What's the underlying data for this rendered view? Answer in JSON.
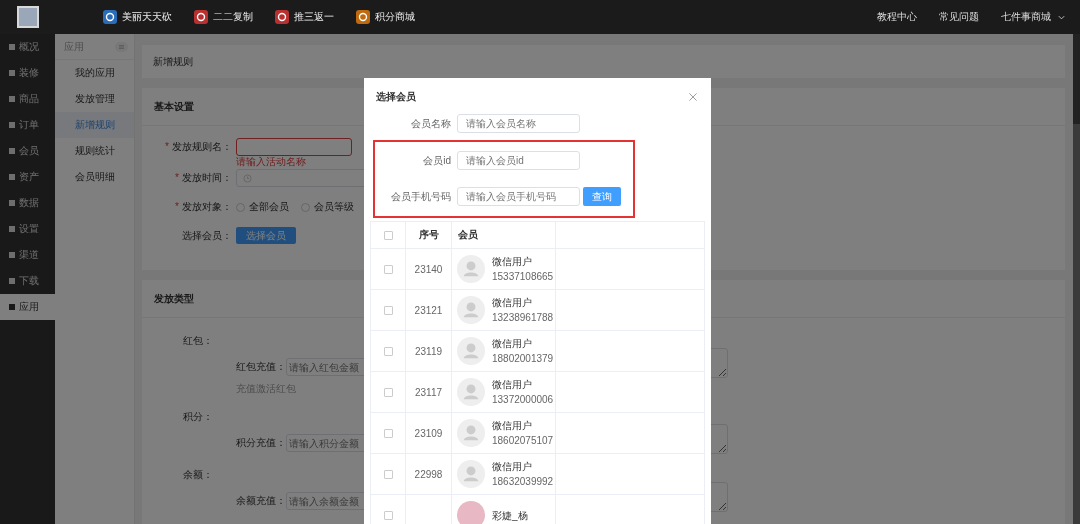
{
  "top_bar": {
    "nav": [
      {
        "label": "美丽天天砍",
        "color": "#2a6cb8"
      },
      {
        "label": "二二复制",
        "color": "#b83030"
      },
      {
        "label": "推三返一",
        "color": "#b83030"
      },
      {
        "label": "积分商城",
        "color": "#c06a10"
      }
    ],
    "links": [
      "教程中心",
      "常见问题"
    ],
    "shop_menu": "七件事商城"
  },
  "sidebar": {
    "items": [
      {
        "label": "概况",
        "selected": false
      },
      {
        "label": "装修",
        "selected": false
      },
      {
        "label": "商品",
        "selected": false
      },
      {
        "label": "订单",
        "selected": false
      },
      {
        "label": "会员",
        "selected": false
      },
      {
        "label": "资产",
        "selected": false
      },
      {
        "label": "数据",
        "selected": false
      },
      {
        "label": "设置",
        "selected": false
      },
      {
        "label": "渠道",
        "selected": false
      },
      {
        "label": "下载",
        "selected": false
      },
      {
        "label": "应用",
        "selected": true
      }
    ]
  },
  "sub_sidebar": {
    "title": "应用",
    "items": [
      {
        "label": "我的应用",
        "selected": false
      },
      {
        "label": "发放管理",
        "selected": false
      },
      {
        "label": "新增规则",
        "selected": true
      },
      {
        "label": "规则统计",
        "selected": false
      },
      {
        "label": "会员明细",
        "selected": false
      }
    ]
  },
  "breadcrumb": "新增规则",
  "basic_settings": {
    "title": "基本设置",
    "rule_name": {
      "required_mark": "*",
      "label": "发放规则名：",
      "error": "请输入活动名称"
    },
    "time": {
      "required_mark": "*",
      "label": "发放时间："
    },
    "target": {
      "required_mark": "*",
      "label": "发放对象：",
      "options": [
        {
          "label": "全部会员",
          "selected": false
        },
        {
          "label": "会员等级",
          "selected": false
        }
      ]
    },
    "member": {
      "label": "选择会员：",
      "button": "选择会员"
    }
  },
  "issue_type": {
    "title": "发放类型",
    "groups": [
      {
        "label": "红包：",
        "field_label": "红包充值：",
        "placeholder": "请输入红包金额",
        "hint": "充值激活红包"
      },
      {
        "label": "积分：",
        "field_label": "积分充值：",
        "placeholder": "请输入积分金额"
      },
      {
        "label": "余额：",
        "field_label": "余额充值：",
        "placeholder": "请输入余额金额"
      }
    ]
  },
  "modal": {
    "title": "选择会员",
    "fields": [
      {
        "label": "会员名称",
        "placeholder": "请输入会员名称",
        "highlighted": false
      },
      {
        "label": "会员id",
        "placeholder": "请输入会员id",
        "highlighted": true
      },
      {
        "label": "会员手机号码",
        "placeholder": "请输入会员手机号码",
        "highlighted": true
      }
    ],
    "query_button": "查询",
    "table": {
      "columns": [
        "序号",
        "会员"
      ],
      "header_checked": false,
      "rows": [
        {
          "checked": false,
          "id": "23140",
          "name": "微信用户",
          "phone": "15337108665"
        },
        {
          "checked": false,
          "id": "23121",
          "name": "微信用户",
          "phone": "13238961788"
        },
        {
          "checked": false,
          "id": "23119",
          "name": "微信用户",
          "phone": "18802001379"
        },
        {
          "checked": false,
          "id": "23117",
          "name": "微信用户",
          "phone": "13372000006"
        },
        {
          "checked": false,
          "id": "23109",
          "name": "微信用户",
          "phone": "18602075107"
        },
        {
          "checked": false,
          "id": "22998",
          "name": "微信用户",
          "phone": "18632039992"
        },
        {
          "checked": false,
          "name": "彩婕_杨",
          "photo": true
        }
      ]
    }
  }
}
